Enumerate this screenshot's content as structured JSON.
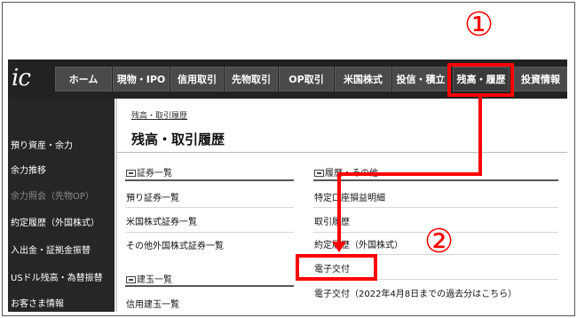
{
  "nav": {
    "logo": "ic",
    "tabs": [
      "ホーム",
      "現物・IPO",
      "信用取引",
      "先物取引",
      "OP取引",
      "米国株式",
      "投信・積立",
      "残高・履歴",
      "投資情報"
    ]
  },
  "sidebar": {
    "items": [
      "預り資産・余力",
      "余力推移",
      "余力照会（先物OP）",
      "約定履歴（外国株式）",
      "入出金・証拠金振替",
      "USドル残高・為替振替",
      "お客さま情報"
    ]
  },
  "page": {
    "breadcrumb": "残高・取引履歴",
    "title": "残高・取引履歴"
  },
  "left_sections": {
    "securities": {
      "heading": "証券一覧",
      "links": [
        "預り証券一覧",
        "米国株式証券一覧",
        "その他外国株式証券一覧"
      ]
    },
    "positions": {
      "heading": "建玉一覧",
      "links": [
        "信用建玉一覧"
      ]
    }
  },
  "right_section": {
    "heading": "履歴・その他",
    "links": [
      "特定口座損益明細",
      "取引履歴",
      "約定履歴（外国株式）",
      "電子交付",
      "電子交付（2022年4月8日までの過去分はこちら）"
    ]
  },
  "annotations": {
    "step1": "①",
    "step2": "②",
    "color": "#ff0000"
  }
}
